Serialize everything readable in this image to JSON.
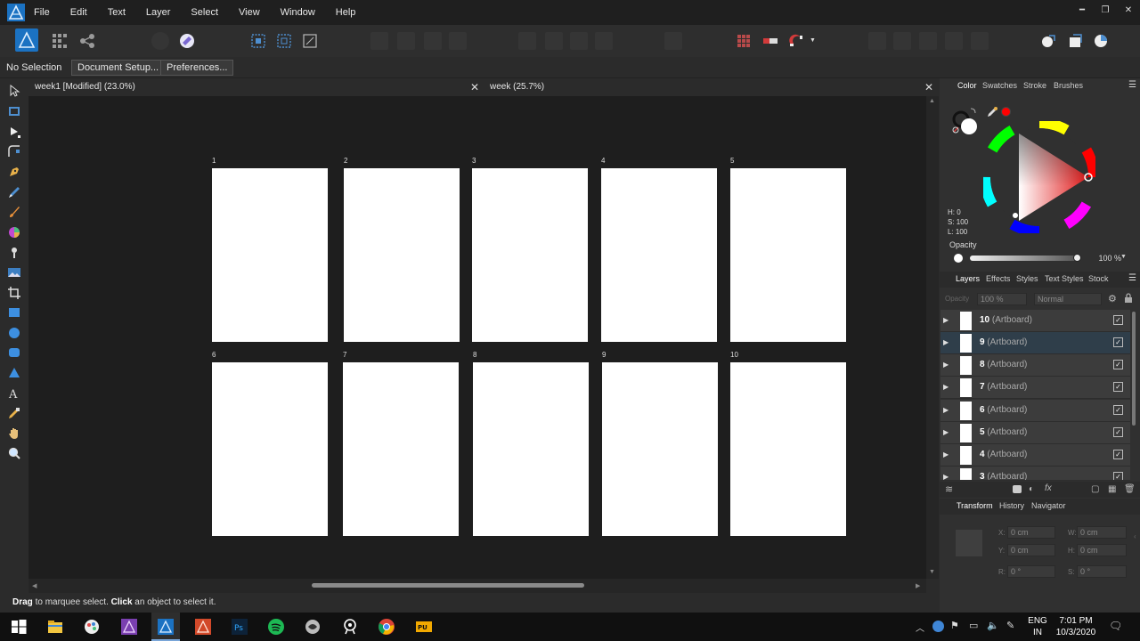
{
  "menubar": {
    "items": [
      "File",
      "Edit",
      "Text",
      "Layer",
      "Select",
      "View",
      "Window",
      "Help"
    ]
  },
  "context": {
    "selection": "No Selection",
    "document_setup": "Document Setup...",
    "preferences": "Preferences..."
  },
  "tabs": [
    {
      "label": "week1 [Modified] (23.0%)",
      "close": "✕"
    },
    {
      "label": "week (25.7%)",
      "close": "✕"
    }
  ],
  "artboards": [
    "1",
    "2",
    "3",
    "4",
    "5",
    "6",
    "7",
    "8",
    "9",
    "10"
  ],
  "status": {
    "drag": "Drag",
    "drag_text": " to marquee select. ",
    "click": "Click",
    "click_text": " an object to select it."
  },
  "color_panel": {
    "tabs": [
      "Color",
      "Swatches",
      "Stroke",
      "Brushes"
    ],
    "h": "H: 0",
    "s": "S: 100",
    "l": "L: 100",
    "opacity_label": "Opacity",
    "opacity_value": "100 %",
    "current_color": "#ff0000"
  },
  "layers_panel": {
    "tabs": [
      "Layers",
      "Effects",
      "Styles",
      "Text Styles",
      "Stock"
    ],
    "opacity_label": "Opacity",
    "opacity_value": "100 %",
    "blend_mode": "Normal",
    "rows": [
      {
        "num": "10",
        "type": "(Artboard)"
      },
      {
        "num": "9",
        "type": "(Artboard)"
      },
      {
        "num": "8",
        "type": "(Artboard)"
      },
      {
        "num": "7",
        "type": "(Artboard)"
      },
      {
        "num": "6",
        "type": "(Artboard)"
      },
      {
        "num": "5",
        "type": "(Artboard)"
      },
      {
        "num": "4",
        "type": "(Artboard)"
      },
      {
        "num": "3",
        "type": "(Artboard)"
      }
    ],
    "selected_index": 1
  },
  "transform_panel": {
    "tabs": [
      "Transform",
      "History",
      "Navigator"
    ],
    "x_label": "X:",
    "x": "0 cm",
    "y_label": "Y:",
    "y": "0 cm",
    "w_label": "W:",
    "w": "0 cm",
    "h_label": "H:",
    "h": "0 cm",
    "r_label": "R:",
    "r": "0 °",
    "s_label": "S:",
    "s": "0 °"
  },
  "taskbar": {
    "lang_line1": "ENG",
    "lang_line2": "IN",
    "time": "7:01 PM",
    "date": "10/3/2020"
  }
}
